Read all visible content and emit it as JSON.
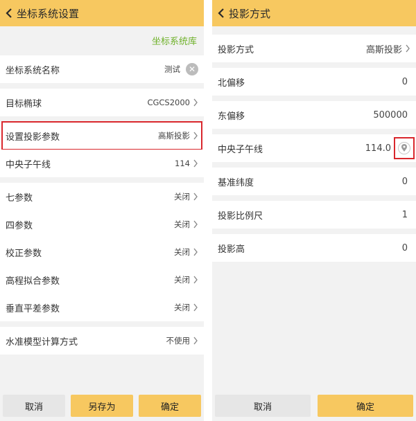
{
  "left": {
    "title": "坐标系统设置",
    "library_link": "坐标系统库",
    "rows": [
      {
        "label": "坐标系统名称",
        "value": "测试"
      },
      {
        "label": "目标椭球",
        "value": "CGCS2000"
      },
      {
        "label": "设置投影参数",
        "value": "高斯投影"
      },
      {
        "label": "中央子午线",
        "value": "114"
      },
      {
        "label": "七参数",
        "value": "关闭"
      },
      {
        "label": "四参数",
        "value": "关闭"
      },
      {
        "label": "校正参数",
        "value": "关闭"
      },
      {
        "label": "高程拟合参数",
        "value": "关闭"
      },
      {
        "label": "垂直平差参数",
        "value": "关闭"
      },
      {
        "label": "水准模型计算方式",
        "value": "不使用"
      }
    ],
    "buttons": {
      "cancel": "取消",
      "save_as": "另存为",
      "ok": "确定"
    }
  },
  "right": {
    "title": "投影方式",
    "rows": [
      {
        "label": "投影方式",
        "value": "高斯投影"
      },
      {
        "label": "北偏移",
        "value": "0"
      },
      {
        "label": "东偏移",
        "value": "500000"
      },
      {
        "label": "中央子午线",
        "value": "114.0"
      },
      {
        "label": "基准纬度",
        "value": "0"
      },
      {
        "label": "投影比例尺",
        "value": "1"
      },
      {
        "label": "投影高",
        "value": "0"
      }
    ],
    "buttons": {
      "cancel": "取消",
      "ok": "确定"
    }
  },
  "colors": {
    "header": "#f7c860",
    "link": "#6fb12a",
    "highlight": "#d9262c"
  }
}
